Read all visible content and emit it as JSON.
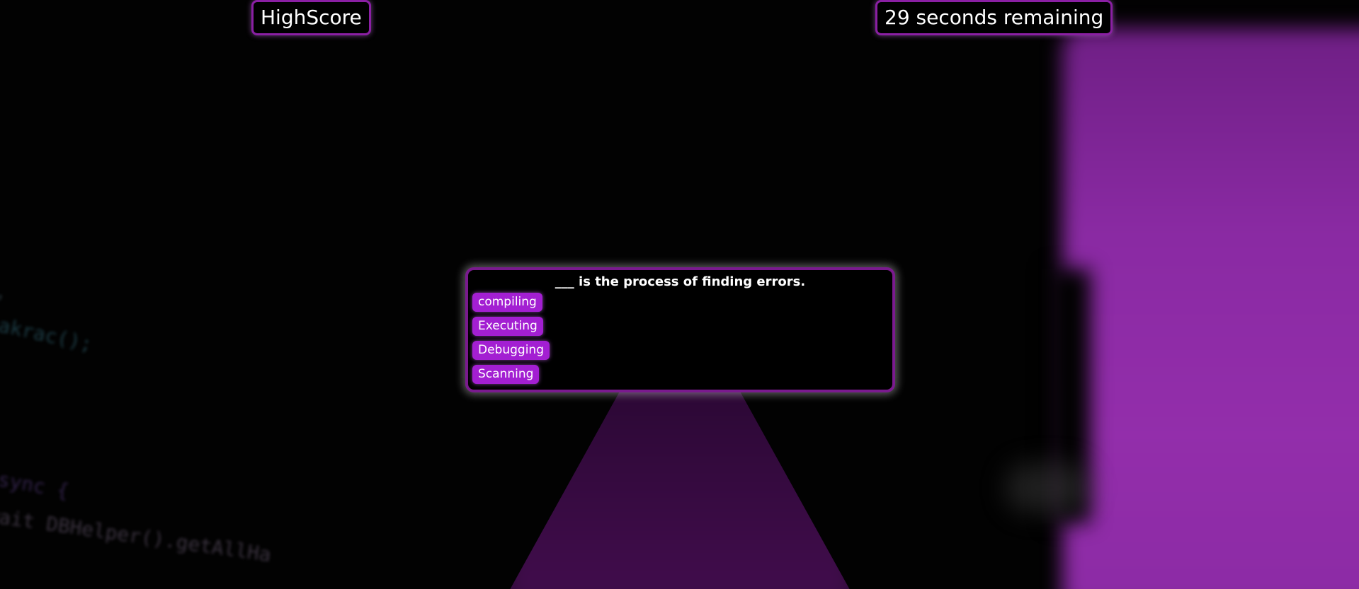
{
  "header": {
    "highscore_label": "HighScore",
    "timer_text": "29 seconds remaining"
  },
  "quiz": {
    "question": "___ is the process of finding errors.",
    "answers": [
      "compiling",
      "Executing",
      "Debugging",
      "Scanning"
    ]
  },
  "background": {
    "code_fragments": [
      ",",
      "eakrac();",
      "async {",
      "wait DBHelper().getAllHa"
    ]
  },
  "colors": {
    "accent": "#a31fd2",
    "border": "#7a1a8e",
    "background": "#020202"
  }
}
